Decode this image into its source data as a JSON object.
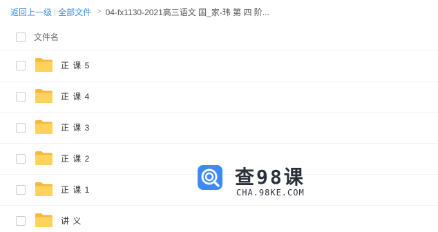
{
  "breadcrumb": {
    "back": "返回上一级",
    "separator": "|",
    "all_files": "全部文件",
    "arrow": ">",
    "current": "04-fx1130-2021高三语文 国_家-玮 第 四 阶..."
  },
  "list": {
    "header_label": "文件名",
    "items": [
      {
        "label": "正 课 5"
      },
      {
        "label": "正 课 4"
      },
      {
        "label": "正 课 3"
      },
      {
        "label": "正 课 2"
      },
      {
        "label": "正 课 1"
      },
      {
        "label": "讲 义"
      }
    ]
  },
  "icons": {
    "folder": "folder-icon",
    "checkbox": "checkbox"
  },
  "colors": {
    "link": "#3a8ee6",
    "folder": "#ffc94d",
    "watermark_blue": "#3d8bf2"
  },
  "watermark": {
    "title": "查98课",
    "subtitle": "CHA.98KE.COM"
  }
}
